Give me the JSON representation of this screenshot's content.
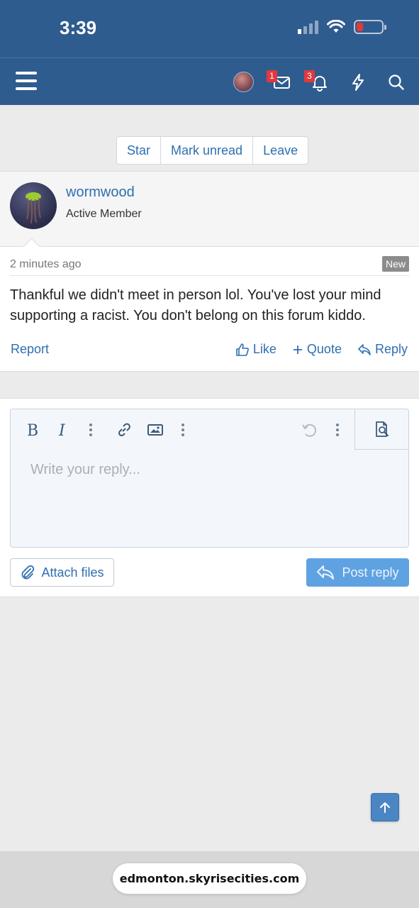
{
  "status_bar": {
    "time": "3:39"
  },
  "nav": {
    "inbox_badge": "1",
    "alerts_badge": "3"
  },
  "thread_actions": [
    "Star",
    "Mark unread",
    "Leave"
  ],
  "post": {
    "username": "wormwood",
    "user_title": "Active Member",
    "time": "2 minutes ago",
    "badge": "New",
    "body": "Thankful we didn't meet in person lol. You've lost your mind supporting a racist. You don't belong on this forum kiddo.",
    "report_label": "Report",
    "like_label": "Like",
    "quote_label": "Quote",
    "reply_label": "Reply"
  },
  "editor": {
    "placeholder": "Write your reply...",
    "attach_label": "Attach files",
    "post_label": "Post reply"
  },
  "browser": {
    "url": "edmonton.skyrisecities.com"
  },
  "colors": {
    "header": "#2f5c8f",
    "link": "#2f6fb0",
    "primary_button": "#5fa2e2",
    "badge": "#e0393e"
  }
}
